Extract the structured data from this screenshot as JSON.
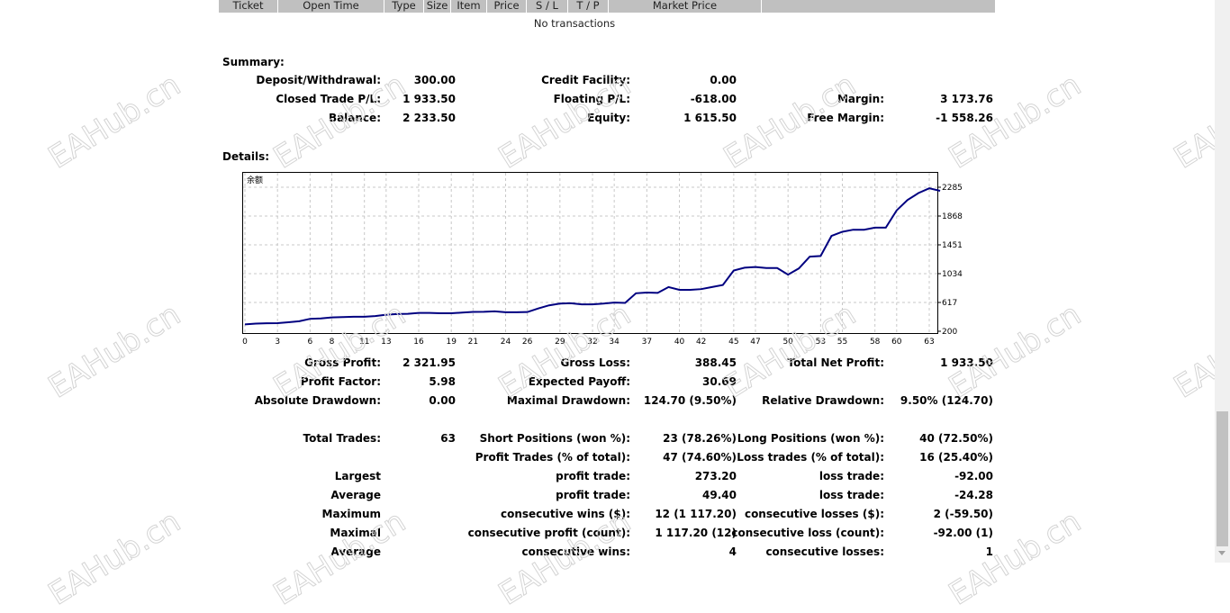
{
  "table": {
    "columns": [
      "Ticket",
      "Open Time",
      "Type",
      "Size",
      "Item",
      "Price",
      "S / L",
      "T / P",
      "Market Price",
      ""
    ],
    "empty_text": "No transactions"
  },
  "summary": {
    "title": "Summary:",
    "rows": [
      [
        [
          "Deposit/Withdrawal:",
          "300.00"
        ],
        [
          "Credit Facility:",
          "0.00"
        ],
        [
          "",
          ""
        ]
      ],
      [
        [
          "Closed Trade P/L:",
          "1 933.50"
        ],
        [
          "Floating P/L:",
          "-618.00"
        ],
        [
          "Margin:",
          "3 173.76"
        ]
      ],
      [
        [
          "Balance:",
          "2 233.50"
        ],
        [
          "Equity:",
          "1 615.50"
        ],
        [
          "Free Margin:",
          "-1 558.26"
        ]
      ]
    ]
  },
  "details": {
    "title": "Details:",
    "rows": [
      [
        [
          "Gross Profit:",
          "2 321.95"
        ],
        [
          "Gross Loss:",
          "388.45"
        ],
        [
          "Total Net Profit:",
          "1 933.50"
        ]
      ],
      [
        [
          "Profit Factor:",
          "5.98"
        ],
        [
          "Expected Payoff:",
          "30.69"
        ],
        [
          "",
          ""
        ]
      ],
      [
        [
          "Absolute Drawdown:",
          "0.00"
        ],
        [
          "Maximal Drawdown:",
          "124.70 (9.50%)"
        ],
        [
          "Relative Drawdown:",
          "9.50% (124.70)"
        ]
      ],
      [
        [
          "Total Trades:",
          "63"
        ],
        [
          "Short Positions (won %):",
          "23 (78.26%)"
        ],
        [
          "Long Positions (won %):",
          "40 (72.50%)"
        ]
      ],
      [
        [
          "",
          ""
        ],
        [
          "Profit Trades (% of total):",
          "47 (74.60%)"
        ],
        [
          "Loss trades (% of total):",
          "16 (25.40%)"
        ]
      ],
      [
        [
          "Largest",
          ""
        ],
        [
          "profit trade:",
          "273.20"
        ],
        [
          "loss trade:",
          "-92.00"
        ]
      ],
      [
        [
          "Average",
          ""
        ],
        [
          "profit trade:",
          "49.40"
        ],
        [
          "loss trade:",
          "-24.28"
        ]
      ],
      [
        [
          "Maximum",
          ""
        ],
        [
          "consecutive wins ($):",
          "12 (1 117.20)"
        ],
        [
          "consecutive losses ($):",
          "2 (-59.50)"
        ]
      ],
      [
        [
          "Maximal",
          ""
        ],
        [
          "consecutive profit (count):",
          "1 117.20 (12)"
        ],
        [
          "consecutive loss (count):",
          "-92.00 (1)"
        ]
      ],
      [
        [
          "Average",
          ""
        ],
        [
          "consecutive wins:",
          "4"
        ],
        [
          "consecutive losses:",
          "1"
        ]
      ]
    ]
  },
  "watermark": "EAHub.cn",
  "chart_data": {
    "type": "line",
    "title": "余额",
    "xlabel": "",
    "ylabel": "",
    "xlim": [
      0,
      64
    ],
    "ylim": [
      200,
      2285
    ],
    "xticks": [
      0,
      3,
      6,
      8,
      11,
      13,
      16,
      19,
      21,
      24,
      26,
      29,
      32,
      34,
      37,
      40,
      42,
      45,
      47,
      50,
      53,
      55,
      58,
      60,
      63
    ],
    "yticks": [
      200,
      617,
      1034,
      1451,
      1868,
      2285
    ],
    "grid": true,
    "color": "#000080",
    "series": [
      {
        "name": "余额",
        "values": [
          300,
          310,
          315,
          318,
          330,
          345,
          380,
          385,
          400,
          405,
          410,
          410,
          420,
          440,
          450,
          452,
          465,
          465,
          460,
          460,
          470,
          480,
          482,
          488,
          475,
          475,
          478,
          530,
          575,
          600,
          605,
          590,
          590,
          600,
          615,
          610,
          750,
          760,
          755,
          840,
          800,
          800,
          810,
          840,
          870,
          1080,
          1120,
          1130,
          1115,
          1115,
          1020,
          1110,
          1280,
          1290,
          1580,
          1640,
          1670,
          1670,
          1700,
          1700,
          1950,
          2100,
          2200,
          2270,
          2233
        ]
      }
    ]
  }
}
